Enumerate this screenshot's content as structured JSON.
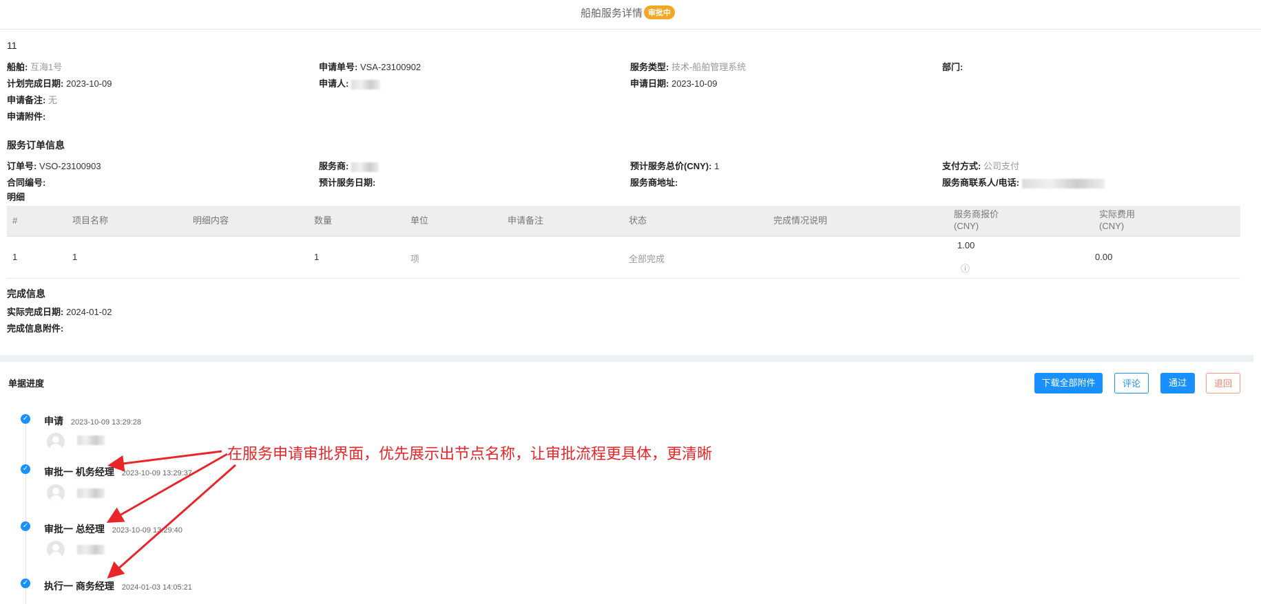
{
  "header": {
    "title": "船舶服务详情",
    "status_badge": "审批中"
  },
  "record_id": "11",
  "application": {
    "ship_label": "船舶:",
    "ship_value": "互海1号",
    "apply_no_label": "申请单号:",
    "apply_no_value": "VSA-23100902",
    "service_type_label": "服务类型:",
    "service_type_value": "技术-船舶管理系统",
    "dept_label": "部门:",
    "plan_date_label": "计划完成日期:",
    "plan_date_value": "2023-10-09",
    "applicant_label": "申请人:",
    "apply_date_label": "申请日期:",
    "apply_date_value": "2023-10-09",
    "remark_label": "申请备注:",
    "remark_value": "无",
    "attachment_label": "申请附件:"
  },
  "order": {
    "section_title": "服务订单信息",
    "order_no_label": "订单号:",
    "order_no_value": "VSO-23100903",
    "provider_label": "服务商:",
    "total_label": "预计服务总价(CNY):",
    "total_value": "1",
    "payment_label": "支付方式:",
    "payment_value": "公司支付",
    "contract_label": "合同编号:",
    "service_date_label": "预计服务日期:",
    "provider_addr_label": "服务商地址:",
    "provider_contact_label": "服务商联系人/电话:",
    "detail_title": "明细"
  },
  "table": {
    "headers": [
      "#",
      "项目名称",
      "明细内容",
      "数量",
      "单位",
      "申请备注",
      "状态",
      "完成情况说明"
    ],
    "header_quote_line1": "服务商报价",
    "header_quote_line2": "(CNY)",
    "header_cost_line1": "实际费用",
    "header_cost_line2": "(CNY)",
    "rows": [
      {
        "no": "1",
        "item": "1",
        "detail": "",
        "qty": "1",
        "unit": "项",
        "remark": "",
        "status": "全部完成",
        "completion": "",
        "quote": "1.00",
        "info_icon": "ⓘ",
        "cost": "0.00"
      }
    ]
  },
  "completion": {
    "section_title": "完成信息",
    "actual_date_label": "实际完成日期:",
    "actual_date_value": "2024-01-02",
    "attachment_label": "完成信息附件:"
  },
  "progress": {
    "title": "单据进度",
    "buttons": {
      "download_all": "下载全部附件",
      "comment": "评论",
      "approve": "通过",
      "return": "退回"
    },
    "nodes": [
      {
        "name": "申请",
        "time": "2023-10-09 13:29:28"
      },
      {
        "name": "审批一 机务经理",
        "time": "2023-10-09 13:29:37"
      },
      {
        "name": "审批一 总经理",
        "time": "2023-10-09 13:29:40"
      },
      {
        "name": "执行一 商务经理",
        "time": "2024-01-03 14:05:21"
      }
    ],
    "check_icon": "✓"
  },
  "annotation": "在服务申请审批界面，优先展示出节点名称，让审批流程更具体，更清晰",
  "colors": {
    "accent": "#1890ff",
    "badge": "#f5a623",
    "annotation": "#e8262a",
    "return": "#f0806b"
  }
}
